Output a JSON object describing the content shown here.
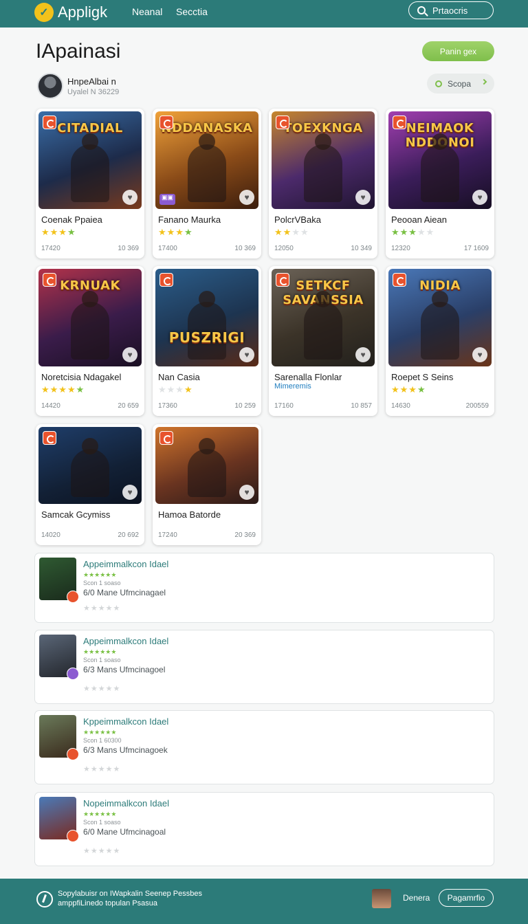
{
  "topbar": {
    "app_name": "Appligk",
    "nav": [
      "Neanal",
      "Secctia"
    ],
    "search_label": "Prtaocris"
  },
  "header": {
    "title": "IApainasi",
    "primary_button": "Panin gex",
    "user_name": "HnpeAlbai n",
    "user_sub": "Uyalel N 36229",
    "scope_label": "Scopa"
  },
  "cards": [
    {
      "art_title": "CITADIAL",
      "name": "Coenak Ppaiea",
      "meta_left": "17420",
      "meta_right": "10 369"
    },
    {
      "art_title": "NDDANASKA",
      "name": "Fanano Maurka",
      "meta_left": "17400",
      "meta_right": "10 369"
    },
    {
      "art_title": "TOEXKNGA",
      "name": "PolcrVBaka",
      "meta_left": "12050",
      "meta_right": "10 349"
    },
    {
      "art_title": "NEIMAOK NDDONOI",
      "name": "Peooan Aiean",
      "meta_left": "12320",
      "meta_right": "17 1609"
    },
    {
      "art_title": "KRNUAK",
      "name": "Noretcisia Ndagakel",
      "meta_left": "14420",
      "meta_right": "20 659"
    },
    {
      "art_title": "PUSZRIGI",
      "name": "Nan Casia",
      "meta_left": "17360",
      "meta_right": "10 259"
    },
    {
      "art_title": "SETKCF SAVANSSIA",
      "name": "Sarenalla Flonlar",
      "sub": "Mimeremis",
      "meta_left": "17160",
      "meta_right": "10 857"
    },
    {
      "art_title": "NIDIA",
      "name": "Roepet S Seins",
      "meta_left": "14630",
      "meta_right": "200559"
    },
    {
      "art_title": "",
      "name": "Samcak Gcymiss",
      "meta_left": "14020",
      "meta_right": "20 692"
    },
    {
      "art_title": "",
      "name": "Hamoa Batorde",
      "meta_left": "17240",
      "meta_right": "20 369"
    }
  ],
  "list": [
    {
      "title": "Appeimmalkcon Idael",
      "meta": "Scon 1 soaso",
      "desc": "6/0 Mane Ufmcinagael"
    },
    {
      "title": "Appeimmalkcon Idael",
      "meta": "Scon 1 soaso",
      "desc": "6/3 Mans Ufmcinagoel"
    },
    {
      "title": "Kppeimmalkcon Idael",
      "meta": "Scon 1 60300",
      "desc": "6/3 Mans Ufmcinagoek"
    },
    {
      "title": "Nopeimmalkcon Idael",
      "meta": "Scon 1 soaso",
      "desc": "6/0 Mane Ufmcinagoal"
    }
  ],
  "footer": {
    "line1": "Sopylabuisr on IWapkalin Seenep Pessbes",
    "line2": "amppfiLinedo topulan Psasua",
    "link": "Denera",
    "button": "Pagamrfio"
  },
  "colors": {
    "brand": "#2c7b79",
    "accent": "#7fbf4b",
    "star": "#f2c21b"
  }
}
